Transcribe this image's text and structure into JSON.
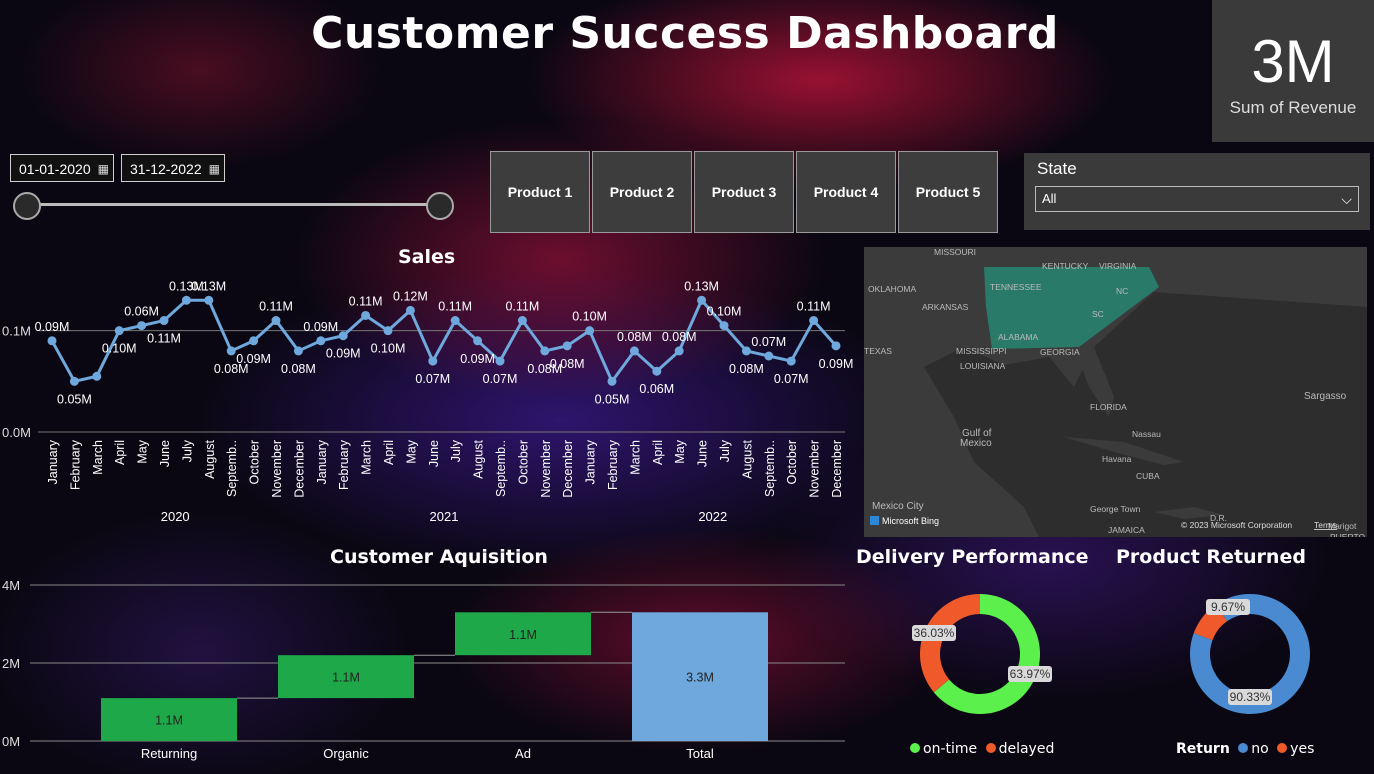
{
  "header": {
    "title": "Customer Success Dashboard"
  },
  "kpi": {
    "value": "3M",
    "label": "Sum of Revenue"
  },
  "date_range": {
    "start": "01-01-2020",
    "end": "31-12-2022",
    "calendar_icon": "calendar-icon"
  },
  "products": [
    "Product 1",
    "Product 2",
    "Product 3",
    "Product 4",
    "Product 5"
  ],
  "state_filter": {
    "label": "State",
    "selected": "All",
    "chevron_icon": "chevron-down-icon"
  },
  "map": {
    "labels": [
      "MISSOURI",
      "KENTUCKY",
      "VIRGINIA",
      "OKLAHOMA",
      "TENNESSEE",
      "NC",
      "ARKANSAS",
      "SC",
      "ALABAMA",
      "MISSISSIPPI",
      "GEORGIA",
      "TEXAS",
      "LOUISIANA",
      "FLORIDA",
      "Sargasso",
      "Gulf of",
      "Mexico",
      "Nassau",
      "Havana",
      "CUBA",
      "Mexico City",
      "George Town",
      "JAMAICA",
      "D.R.",
      "Marigot",
      "PUERTO"
    ],
    "attribution": "Microsoft Bing",
    "copyright": "© 2023 Microsoft Corporation",
    "terms": "Terms",
    "highlight_color": "#2a7a6a"
  },
  "chart_data": [
    {
      "type": "line",
      "title": "Sales",
      "x": [
        "January",
        "February",
        "March",
        "April",
        "May",
        "June",
        "July",
        "August",
        "Septemb..",
        "October",
        "November",
        "December",
        "January",
        "February",
        "March",
        "April",
        "May",
        "June",
        "July",
        "August",
        "Septemb..",
        "October",
        "November",
        "December",
        "January",
        "February",
        "March",
        "April",
        "May",
        "June",
        "July",
        "August",
        "Septemb..",
        "October",
        "November",
        "December"
      ],
      "x_groups": [
        {
          "name": "2020",
          "count": 12
        },
        {
          "name": "2021",
          "count": 12
        },
        {
          "name": "2022",
          "count": 12
        }
      ],
      "values": [
        0.09,
        0.05,
        0.055,
        0.1,
        0.105,
        0.11,
        0.13,
        0.13,
        0.08,
        0.09,
        0.11,
        0.08,
        0.09,
        0.095,
        0.115,
        0.1,
        0.12,
        0.07,
        0.11,
        0.09,
        0.07,
        0.11,
        0.08,
        0.085,
        0.1,
        0.05,
        0.08,
        0.06,
        0.08,
        0.13,
        0.105,
        0.08,
        0.075,
        0.07,
        0.11,
        0.085
      ],
      "data_labels": [
        "0.09M",
        "0.05M",
        "",
        "0.10M",
        "0.06M",
        "0.11M",
        "0.13M",
        "0.13M",
        "0.08M",
        "0.09M",
        "0.11M",
        "0.08M",
        "0.09M",
        "0.09M",
        "0.11M",
        "0.10M",
        "0.12M",
        "0.07M",
        "0.11M",
        "0.09M",
        "0.07M",
        "0.11M",
        "0.08M",
        "0.08M",
        "0.10M",
        "0.05M",
        "0.08M",
        "0.06M",
        "0.08M",
        "0.13M",
        "0.10M",
        "0.08M",
        "0.07M",
        "0.07M",
        "0.11M",
        "0.09M"
      ],
      "y_ticks": [
        "0.0M",
        "0.1M"
      ],
      "ylim": [
        0,
        0.15
      ],
      "color": "#6fa8dc"
    },
    {
      "type": "bar",
      "subtype": "waterfall",
      "title": "Customer Aquisition",
      "categories": [
        "Returning",
        "Organic",
        "Ad",
        "Total"
      ],
      "values": [
        1.1,
        1.1,
        1.1,
        3.3
      ],
      "labels": [
        "1.1M",
        "1.1M",
        "1.1M",
        "3.3M"
      ],
      "y_ticks": [
        "0M",
        "2M",
        "4M"
      ],
      "ylim": [
        0,
        4
      ],
      "colors": {
        "increase": "#1ea84a",
        "total": "#6fa8dc"
      }
    },
    {
      "type": "pie",
      "subtype": "donut",
      "title": "Delivery Performance",
      "series": [
        {
          "name": "on-time",
          "value": 63.97,
          "label": "63.97%",
          "color": "#5cf04c"
        },
        {
          "name": "delayed",
          "value": 36.03,
          "label": "36.03%",
          "color": "#f05a2a"
        }
      ]
    },
    {
      "type": "pie",
      "subtype": "donut",
      "title": "Product Returned",
      "legend_title": "Return",
      "series": [
        {
          "name": "no",
          "value": 90.33,
          "label": "90.33%",
          "color": "#4a8ad0"
        },
        {
          "name": "yes",
          "value": 9.67,
          "label": "9.67%",
          "color": "#f05a2a"
        }
      ]
    }
  ]
}
